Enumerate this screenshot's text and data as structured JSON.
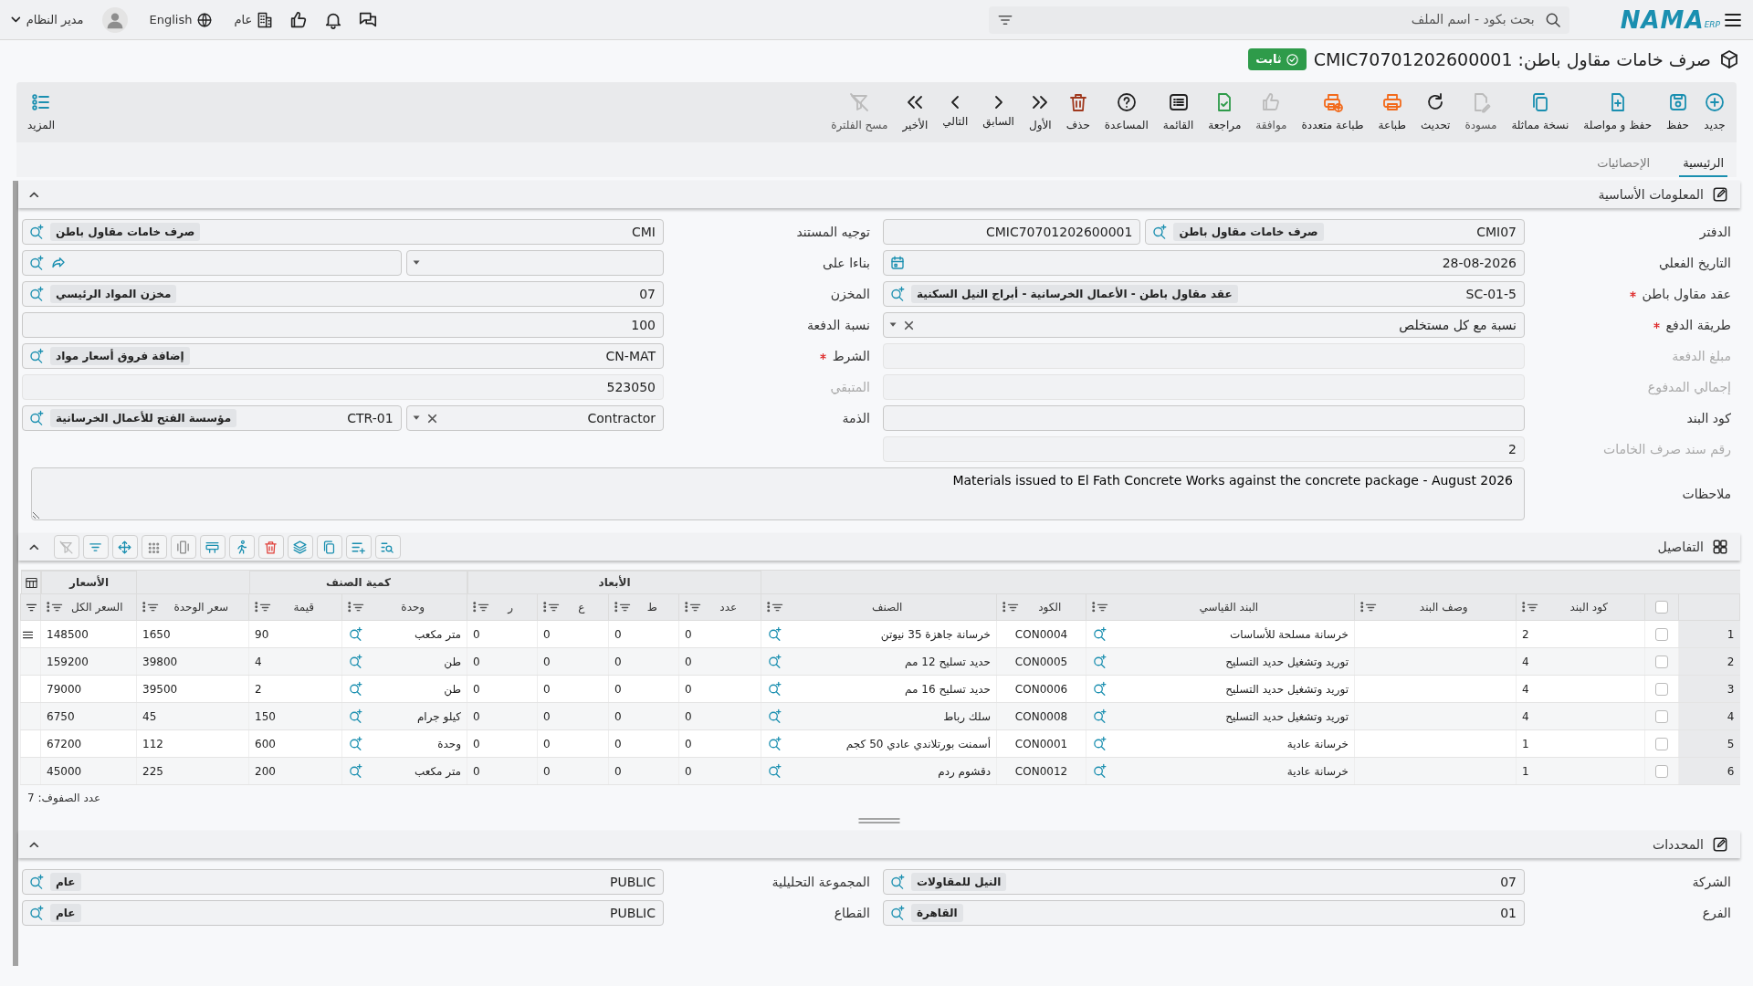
{
  "topbar": {
    "logo": "NAMA",
    "logo_sub": "ERP",
    "search": {
      "placeholder": "بحث بكود - اسم الملف"
    },
    "company": "عام",
    "language": "English",
    "user": "مدير النظام"
  },
  "title": "صرف خامات مقاول باطن: CMIC70701202600001",
  "status": "ثابت",
  "toolbar": [
    {
      "kind": "new",
      "label": "جديد",
      "disabled": false
    },
    {
      "kind": "save",
      "label": "حفظ",
      "disabled": false
    },
    {
      "kind": "savenext",
      "label": "حفظ و مواصلة",
      "disabled": false
    },
    {
      "kind": "duplicate",
      "label": "نسخة مماثلة",
      "disabled": false
    },
    {
      "kind": "draft",
      "label": "مسودة",
      "disabled": true
    },
    {
      "kind": "refresh",
      "label": "تحديث",
      "disabled": false
    },
    {
      "kind": "print",
      "label": "طباعة",
      "disabled": false
    },
    {
      "kind": "multiprint",
      "label": "طباعة متعددة",
      "disabled": false
    },
    {
      "kind": "approve",
      "label": "موافقة",
      "disabled": true
    },
    {
      "kind": "review",
      "label": "مراجعة",
      "disabled": false
    },
    {
      "kind": "list",
      "label": "القائمة",
      "disabled": false
    },
    {
      "kind": "help",
      "label": "المساعدة",
      "disabled": false
    },
    {
      "kind": "delete",
      "label": "حذف",
      "disabled": false
    },
    {
      "kind": "first",
      "label": "الأول",
      "disabled": false
    },
    {
      "kind": "prev",
      "label": "السابق",
      "disabled": false
    },
    {
      "kind": "next",
      "label": "التالي",
      "disabled": false
    },
    {
      "kind": "last",
      "label": "الأخير",
      "disabled": false
    },
    {
      "kind": "clearfilter",
      "label": "مسح الفلترة",
      "disabled": true
    }
  ],
  "more": {
    "label": "المزيد"
  },
  "tabs": [
    {
      "label": "الرئيسية",
      "selected": true
    },
    {
      "label": "الإحصائيات",
      "selected": false
    }
  ],
  "basic_info": {
    "title": "المعلومات الأساسية",
    "expanded": true,
    "fields_right": [
      {
        "label": "الدفتر",
        "required": false,
        "disabled": false,
        "controls": [
          {
            "kind": "lookup",
            "value": "CMI07",
            "chip": "صرف خامات مقاول باطن"
          },
          {
            "kind": "text",
            "value": "CMIC70701202600001"
          }
        ]
      },
      {
        "label": "التاريخ الفعلي",
        "required": false,
        "disabled": false,
        "controls": [
          {
            "kind": "date",
            "value": "28-08-2026"
          }
        ]
      },
      {
        "label": "عقد مقاول باطن",
        "required": true,
        "disabled": false,
        "controls": [
          {
            "kind": "lookup",
            "value": "SC-01-5",
            "chip": "عقد مقاول باطن - الأعمال الخرسانية - أبراج النيل السكنية"
          }
        ]
      },
      {
        "label": "طريقة الدفع",
        "required": true,
        "disabled": false,
        "controls": [
          {
            "kind": "select",
            "value": "نسبة مع كل مستخلص",
            "clearable": true
          }
        ]
      },
      {
        "label": "مبلغ الدفعة",
        "required": false,
        "disabled": true,
        "controls": [
          {
            "kind": "text"
          }
        ]
      },
      {
        "label": "إجمالي المدفوع",
        "required": false,
        "disabled": true,
        "controls": [
          {
            "kind": "text"
          }
        ]
      },
      {
        "label": "كود البند",
        "required": false,
        "disabled": false,
        "controls": [
          {
            "kind": "text"
          }
        ]
      },
      {
        "label": "رقم سند صرف الخامات",
        "required": false,
        "disabled": true,
        "controls": [
          {
            "kind": "text",
            "value": "2"
          }
        ]
      }
    ],
    "fields_left": [
      {
        "label": "توجيه المستند",
        "required": false,
        "disabled": false,
        "controls": [
          {
            "kind": "lookup",
            "value": "CMI",
            "chip": "صرف خامات مقاول باطن"
          }
        ]
      },
      {
        "label": "بناءا على",
        "required": false,
        "disabled": false,
        "controls": [
          {
            "kind": "select",
            "clearable": false
          },
          {
            "kind": "reference"
          }
        ]
      },
      {
        "label": "المخزن",
        "required": false,
        "disabled": false,
        "controls": [
          {
            "kind": "lookup",
            "value": "07",
            "chip": "مخزن المواد الرئيسي"
          }
        ]
      },
      {
        "label": "نسبة الدفعة",
        "required": false,
        "disabled": false,
        "controls": [
          {
            "kind": "text",
            "value": "100"
          }
        ]
      },
      {
        "label": "الشرط",
        "required": true,
        "disabled": false,
        "controls": [
          {
            "kind": "lookup",
            "value": "CN-MAT",
            "chip": "إضافة فروق أسعار مواد"
          }
        ]
      },
      {
        "label": "المتبقي",
        "required": false,
        "disabled": true,
        "controls": [
          {
            "kind": "text",
            "value": "523050"
          }
        ]
      },
      {
        "label": "الذمة",
        "required": false,
        "disabled": false,
        "controls": [
          {
            "kind": "select",
            "value": "Contractor",
            "clearable": true
          },
          {
            "kind": "lookup",
            "value": "CTR-01",
            "chip": "مؤسسة الفتح للأعمال الخرسانية"
          }
        ]
      }
    ],
    "notes": {
      "label": "ملاحظات",
      "value": "Materials issued to El Fath Concrete Works against the concrete package - August 2026"
    }
  },
  "details": {
    "title": "التفاصيل",
    "expanded": true,
    "toolbar": [
      {
        "kind": "zoomlist",
        "disabled": false
      },
      {
        "kind": "listadd",
        "disabled": false
      },
      {
        "kind": "copy",
        "disabled": false
      },
      {
        "kind": "layers",
        "disabled": false
      },
      {
        "kind": "trash",
        "disabled": false
      },
      {
        "kind": "run",
        "disabled": false
      },
      {
        "kind": "rowins",
        "disabled": false
      },
      {
        "kind": "colins",
        "disabled": false
      },
      {
        "kind": "dots",
        "disabled": false
      },
      {
        "kind": "move",
        "disabled": false
      },
      {
        "kind": "filterlines",
        "disabled": false
      },
      {
        "kind": "filteroff",
        "disabled": true
      }
    ],
    "columns": [
      {
        "label": "كود البند",
        "lookup": false
      },
      {
        "label": "وصف البند",
        "lookup": false
      },
      {
        "label": "البند القياسي",
        "lookup": true
      },
      {
        "label": "الكود",
        "lookup": false
      },
      {
        "label": "الصنف",
        "lookup": true
      },
      {
        "label": "عدد",
        "lookup": false,
        "group_start": "الأبعاد"
      },
      {
        "label": "ط",
        "lookup": false,
        "in_group": true
      },
      {
        "label": "ع",
        "lookup": false,
        "in_group": true
      },
      {
        "label": "ر",
        "lookup": false,
        "in_group": true
      },
      {
        "label": "وحدة",
        "lookup": true,
        "group_start": "كمية الصنف"
      },
      {
        "label": "قيمة",
        "lookup": false,
        "in_group": true
      },
      {
        "label": "سعر الوحدة",
        "lookup": false
      },
      {
        "label": "السعر الكل",
        "lookup": false,
        "group_start": "الأسعار"
      }
    ],
    "all_checked": false,
    "rows": [
      {
        "number": "1",
        "checked": false,
        "cells": [
          "2",
          null,
          "خرسانة مسلحة للأساسات",
          "CON0004",
          "خرسانة جاهزة 35 نيوتن",
          "0",
          "0",
          "0",
          "0",
          "متر مكعب",
          "90",
          "1650",
          "148500"
        ]
      },
      {
        "number": "2",
        "checked": false,
        "cells": [
          "4",
          null,
          "توريد وتشغيل حديد التسليح",
          "CON0005",
          "حديد تسليح 12 مم",
          "0",
          "0",
          "0",
          "0",
          "طن",
          "4",
          "39800",
          "159200"
        ]
      },
      {
        "number": "3",
        "checked": false,
        "cells": [
          "4",
          null,
          "توريد وتشغيل حديد التسليح",
          "CON0006",
          "حديد تسليح 16 مم",
          "0",
          "0",
          "0",
          "0",
          "طن",
          "2",
          "39500",
          "79000"
        ]
      },
      {
        "number": "4",
        "checked": false,
        "cells": [
          "4",
          null,
          "توريد وتشغيل حديد التسليح",
          "CON0008",
          "سلك رباط",
          "0",
          "0",
          "0",
          "0",
          "كيلو جرام",
          "150",
          "45",
          "6750"
        ]
      },
      {
        "number": "5",
        "checked": false,
        "cells": [
          "1",
          null,
          "خرسانة عادية",
          "CON0001",
          "أسمنت بورتلاندي عادي 50 كجم",
          "0",
          "0",
          "0",
          "0",
          "وحدة",
          "600",
          "112",
          "67200"
        ]
      },
      {
        "number": "6",
        "checked": false,
        "cells": [
          "1",
          null,
          "خرسانة عادية",
          "CON0012",
          "دقشوم ردم",
          "0",
          "0",
          "0",
          "0",
          "متر مكعب",
          "200",
          "225",
          "45000"
        ]
      }
    ],
    "row_count": "عدد الصفوف: 7"
  },
  "dimensions": {
    "title": "المحددات",
    "expanded": true,
    "fields_right": [
      {
        "label": "الشركة",
        "required": false,
        "disabled": false,
        "controls": [
          {
            "kind": "lookup",
            "value": "07",
            "chip": "النيل للمقاولات"
          }
        ]
      },
      {
        "label": "الفرع",
        "required": false,
        "disabled": false,
        "controls": [
          {
            "kind": "lookup",
            "value": "01",
            "chip": "القاهرة"
          }
        ]
      }
    ],
    "fields_left": [
      {
        "label": "المجموعة التحليلية",
        "required": false,
        "disabled": false,
        "controls": [
          {
            "kind": "lookup",
            "value": "PUBLIC",
            "chip": "عام"
          }
        ]
      },
      {
        "label": "القطاع",
        "required": false,
        "disabled": false,
        "controls": [
          {
            "kind": "lookup",
            "value": "PUBLIC",
            "chip": "عام"
          }
        ]
      }
    ]
  }
}
